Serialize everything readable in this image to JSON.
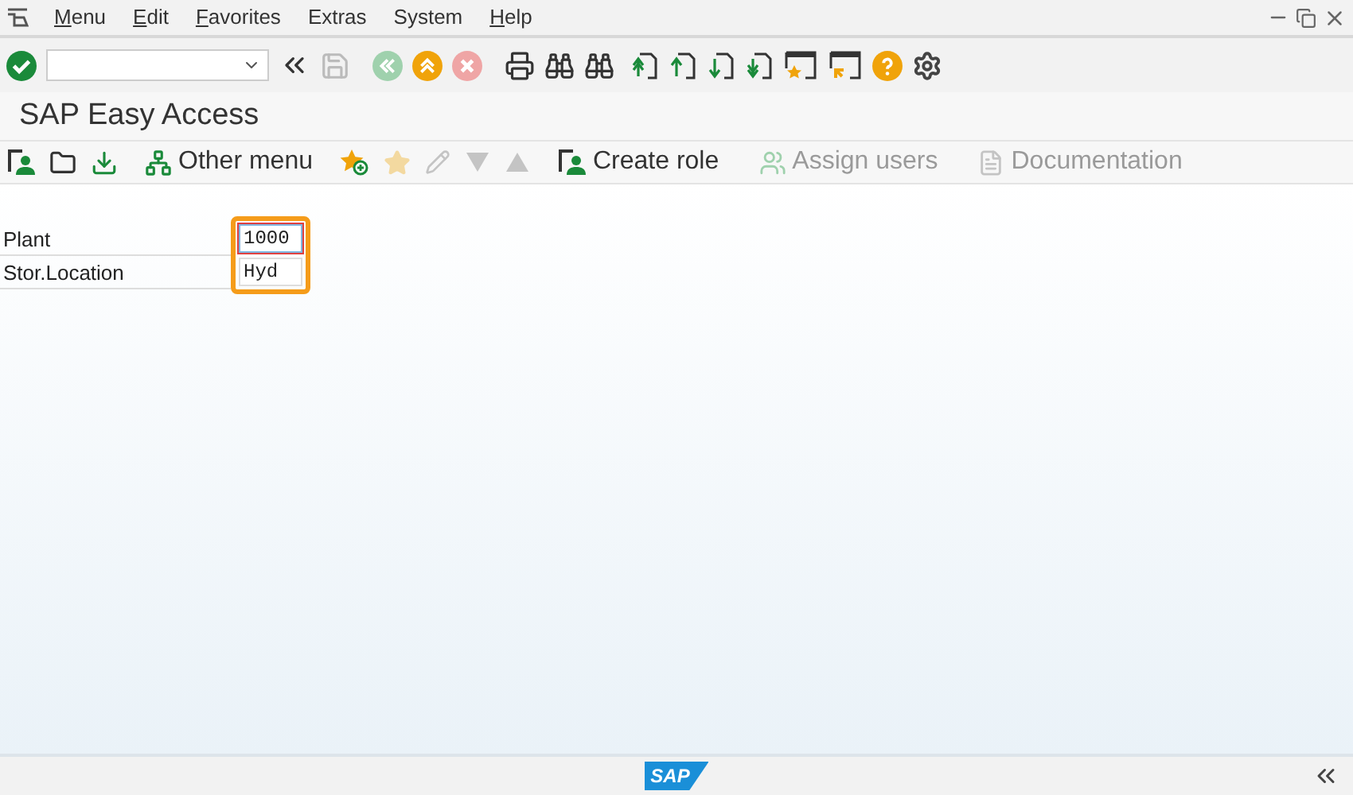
{
  "menu_bar": {
    "items": [
      {
        "label": "Menu",
        "mnemonic": true
      },
      {
        "label": "Edit",
        "mnemonic": true
      },
      {
        "label": "Favorites",
        "mnemonic": true
      },
      {
        "label": "Extras",
        "mnemonic": false
      },
      {
        "label": "System",
        "mnemonic": false
      },
      {
        "label": "Help",
        "mnemonic": true
      }
    ]
  },
  "title": "SAP Easy Access",
  "app_toolbar": [
    {
      "kind": "icon",
      "disabled": false
    },
    {
      "kind": "icon",
      "disabled": false
    },
    {
      "kind": "icon",
      "disabled": false
    },
    {
      "kind": "text",
      "label": "Other menu",
      "disabled": false
    },
    {
      "kind": "icon",
      "disabled": false
    },
    {
      "kind": "icon",
      "disabled": true
    },
    {
      "kind": "icon",
      "disabled": true
    },
    {
      "kind": "icon",
      "disabled": true
    },
    {
      "kind": "icon",
      "disabled": true
    },
    {
      "kind": "text",
      "label": "Create role",
      "disabled": false
    },
    {
      "kind": "text",
      "label": "Assign users",
      "disabled": true
    },
    {
      "kind": "text",
      "label": "Documentation",
      "disabled": true
    }
  ],
  "fields": [
    {
      "label": "Plant",
      "value": "1000",
      "focused": true
    },
    {
      "label": "Stor.Location",
      "value": "Hyd",
      "focused": false
    }
  ],
  "fields_highlighted": true,
  "status_bar": {
    "logo": "SAP"
  }
}
